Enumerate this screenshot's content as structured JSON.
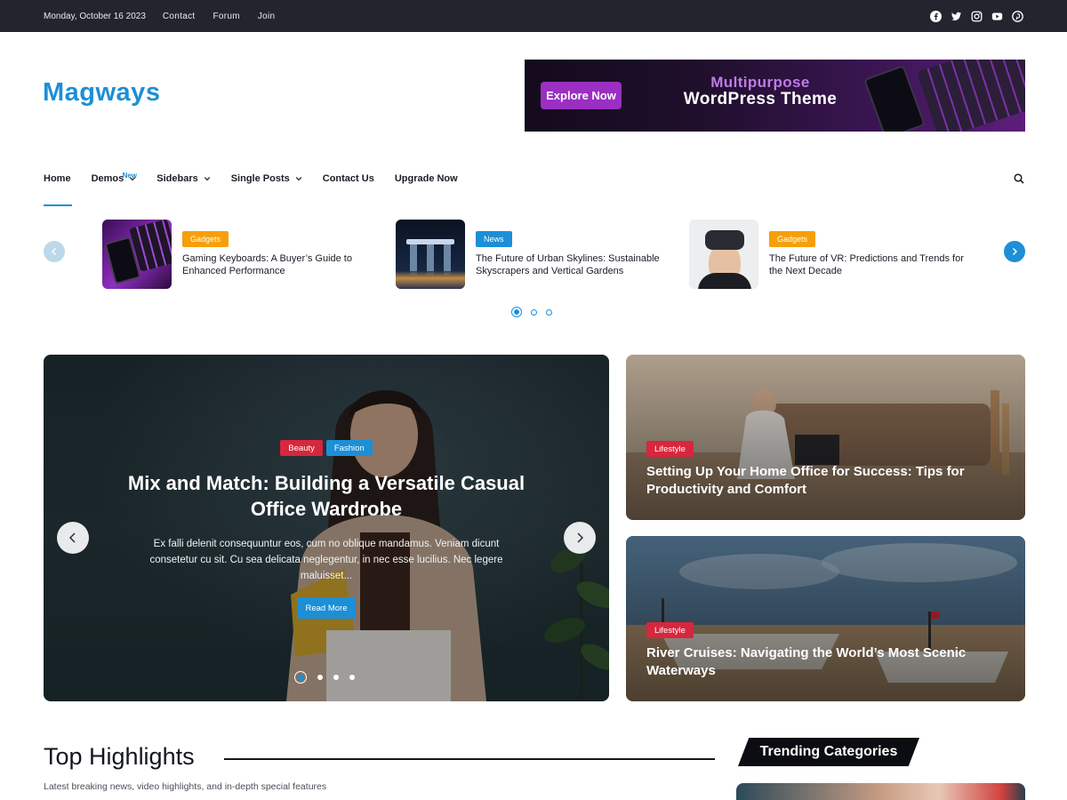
{
  "topbar": {
    "date": "Monday, October 16 2023",
    "links": [
      "Contact",
      "Forum",
      "Join"
    ],
    "social_icons": [
      "facebook-icon",
      "twitter-icon",
      "instagram-icon",
      "youtube-icon",
      "pinterest-icon"
    ]
  },
  "header": {
    "logo": "Magways",
    "banner": {
      "button_label": "Explore Now",
      "line1": "Multipurpose",
      "line2": "WordPress Theme"
    }
  },
  "nav": {
    "items": [
      {
        "label": "Home",
        "active": true,
        "dropdown": false
      },
      {
        "label": "Demos",
        "badge": "New",
        "dropdown": true
      },
      {
        "label": "Sidebars",
        "dropdown": true
      },
      {
        "label": "Single Posts",
        "dropdown": true
      },
      {
        "label": "Contact Us",
        "dropdown": false
      },
      {
        "label": "Upgrade Now",
        "dropdown": false
      }
    ],
    "search_icon": "search-icon"
  },
  "ticker": {
    "items": [
      {
        "category": "Gadgets",
        "category_color": "#f5a00a",
        "title": "Gaming Keyboards: A Buyer’s Guide to Enhanced Performance"
      },
      {
        "category": "News",
        "category_color": "#1c8fd6",
        "title": "The Future of Urban Skylines: Sustainable Skyscrapers and Vertical Gardens"
      },
      {
        "category": "Gadgets",
        "category_color": "#f5a00a",
        "title": "The Future of VR: Predictions and Trends for the Next Decade"
      }
    ],
    "dots": 3,
    "active_dot": 0
  },
  "hero": {
    "tags": [
      {
        "label": "Beauty",
        "color": "#d7263d"
      },
      {
        "label": "Fashion",
        "color": "#1c8fd6"
      }
    ],
    "title": "Mix and Match: Building a Versatile Casual Office Wardrobe",
    "excerpt": "Ex falli delenit consequuntur eos, cum no oblique mandamus. Veniam dicunt consetetur cu sit. Cu sea delicata neglegentur, in nec esse lucilius. Nec legere maluisset...",
    "read_more": "Read More",
    "dots": 4,
    "active_dot": 0
  },
  "side_cards": [
    {
      "tag": "Lifestyle",
      "tag_color": "#d7263d",
      "title": "Setting Up Your Home Office for Success: Tips for Productivity and Comfort"
    },
    {
      "tag": "Lifestyle",
      "tag_color": "#d7263d",
      "title": "River Cruises: Navigating the World’s Most Scenic Waterways"
    }
  ],
  "highlights": {
    "title": "Top Highlights",
    "subtitle": "Latest breaking news, video highlights, and in-depth special features"
  },
  "trending": {
    "title": "Trending Categories"
  },
  "colors": {
    "accent": "#1c8fd6",
    "topbar_bg": "#22252d",
    "gadgets_badge": "#f5a00a",
    "lifestyle_badge": "#d7263d"
  }
}
